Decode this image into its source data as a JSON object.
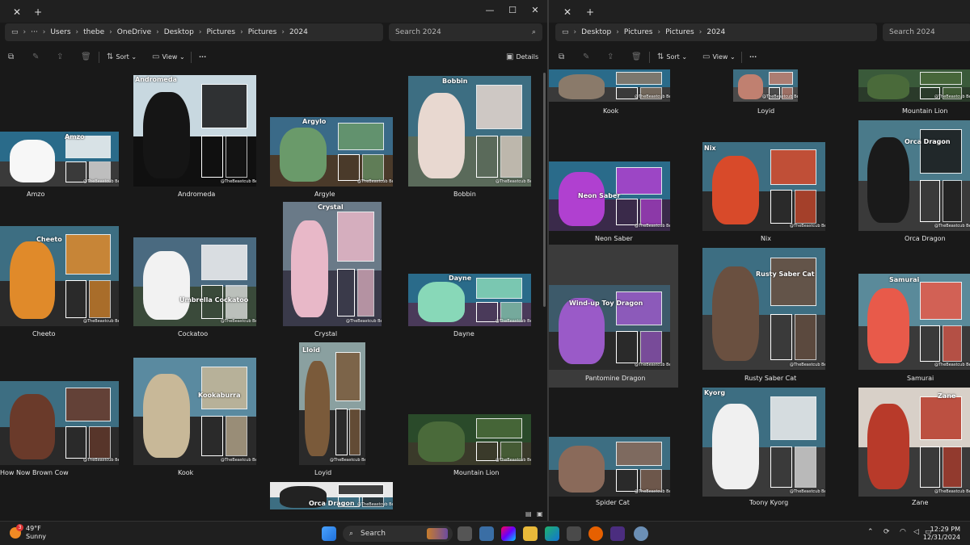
{
  "left_window": {
    "tab_close": "✕",
    "tab_new": "+",
    "controls": {
      "minimize": "—",
      "maximize": "☐",
      "close": "✕"
    },
    "breadcrumbs": [
      "Users",
      "thebe",
      "OneDrive",
      "Desktop",
      "Pictures",
      "Pictures",
      "2024"
    ],
    "overflow": "···",
    "search_placeholder": "Search 2024",
    "toolbar": {
      "sort": "Sort",
      "view": "View",
      "more": "···",
      "details": "Details"
    },
    "items": [
      {
        "label": "Amzo",
        "title": "Amzo"
      },
      {
        "label": "Andromeda",
        "title": "Andromeda"
      },
      {
        "label": "Argyle",
        "title": "Argylo"
      },
      {
        "label": "Bobbin",
        "title": "Bobbin"
      },
      {
        "label": "Cheeto",
        "title": "Cheeto"
      },
      {
        "label": "Cockatoo",
        "title": "Umbrella Cockatoo"
      },
      {
        "label": "Crystal",
        "title": "Crystal"
      },
      {
        "label": "Dayne",
        "title": "Dayne"
      },
      {
        "label": "How Now Brown Cow",
        "title": ""
      },
      {
        "label": "Kook",
        "title": "Kookaburra"
      },
      {
        "label": "Loyid",
        "title": "Lloid"
      },
      {
        "label": "Mountain Lion",
        "title": ""
      },
      {
        "label": "",
        "title": "Orca Dragon"
      }
    ]
  },
  "right_window": {
    "tab_close": "✕",
    "tab_new": "+",
    "breadcrumbs": [
      "Desktop",
      "Pictures",
      "Pictures",
      "2024"
    ],
    "search_placeholder": "Search 2024",
    "toolbar": {
      "sort": "Sort",
      "view": "View",
      "more": "···"
    },
    "items": [
      {
        "label": "Kook",
        "title": ""
      },
      {
        "label": "Loyid",
        "title": ""
      },
      {
        "label": "Mountain Lion",
        "title": ""
      },
      {
        "label": "Neon Saber",
        "title": "Neon Saber"
      },
      {
        "label": "Nix",
        "title": "Nix"
      },
      {
        "label": "Orca Dragon",
        "title": "Orca Dragon"
      },
      {
        "label": "Pantomine Dragon",
        "title": "Wind-up Toy Dragon"
      },
      {
        "label": "Rusty Saber Cat",
        "title": "Rusty Saber Cat"
      },
      {
        "label": "Samurai",
        "title": "Samurai"
      },
      {
        "label": "Spider Cat",
        "title": ""
      },
      {
        "label": "Toony Kyorg",
        "title": "Kyorg"
      },
      {
        "label": "Zane",
        "title": "Zane"
      }
    ]
  },
  "watermark": "@TheBeastcub Beastcub.com",
  "taskbar": {
    "temperature": "49°F",
    "condition": "Sunny",
    "weather_badge": "3",
    "search": "Search",
    "time": "12:29 PM",
    "date": "12/31/2024"
  },
  "colors": {
    "window_bg": "#191919",
    "bar_bg": "#2b2b2b",
    "selection": "#3b3b3b",
    "taskbar_bg": "#1f1f1f"
  }
}
